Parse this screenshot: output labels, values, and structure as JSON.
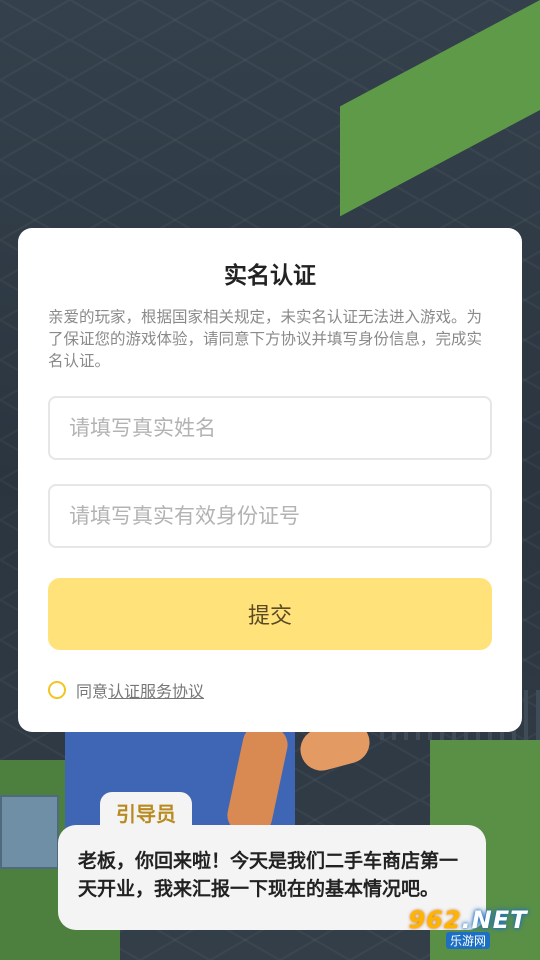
{
  "dialog": {
    "title": "实名认证",
    "description": "亲爱的玩家，根据国家相关规定，未实名认证无法进入游戏。为了保证您的游戏体验，请同意下方协议并填写身份信息，完成实名认证。",
    "name_placeholder": "请填写真实姓名",
    "id_placeholder": "请填写真实有效身份证号",
    "submit_label": "提交",
    "agree_prefix": "同意",
    "agree_link": "认证服务协议"
  },
  "guide": {
    "name": "引导员",
    "message": "老板，你回来啦！今天是我们二手车商店第一天开业，我来汇报一下现在的基本情况吧。"
  },
  "watermark": {
    "logo_num": "962",
    "logo_suffix": ".NET",
    "sub": "乐游网"
  },
  "colors": {
    "accent": "#ffe37a",
    "radio": "#f2c521",
    "guide_name": "#b98a1f"
  }
}
